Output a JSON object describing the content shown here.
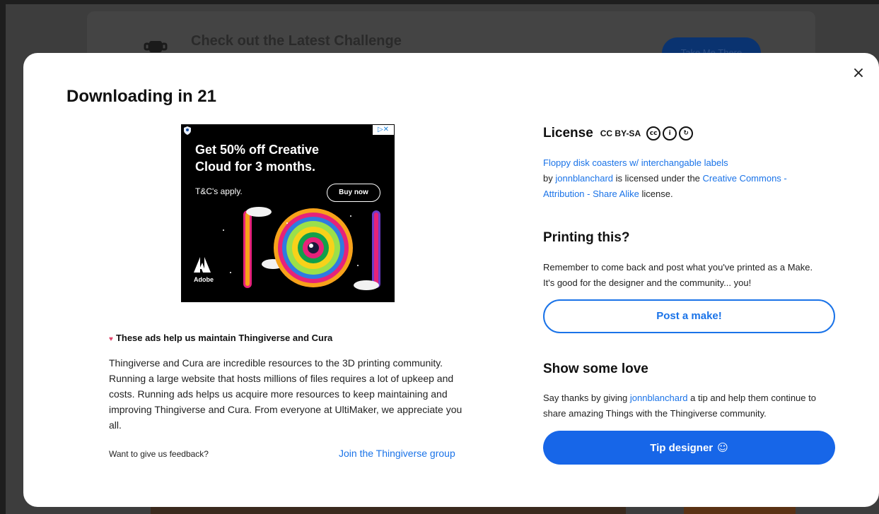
{
  "background": {
    "banner_title": "Check out the Latest Challenge",
    "banner_button": "Take Me There"
  },
  "modal": {
    "title": "Downloading in 21",
    "close_icon": "×",
    "ad": {
      "headline": "Get 50% off Creative Cloud for 3 months.",
      "terms": "T&C's apply.",
      "button": "Buy now",
      "brand": "Adobe",
      "choices_icon": "▷✕"
    },
    "ads_help": {
      "title": "These ads help us maintain Thingiverse and Cura",
      "body": "Thingiverse and Cura are incredible resources to the 3D printing community. Running a large website that hosts millions of files requires a lot of upkeep and costs. Running ads helps us acquire more resources to keep maintaining and improving Thingiverse and Cura. From everyone at UltiMaker, we appreciate you all.",
      "feedback_label": "Want to give us feedback?",
      "feedback_link": "Join the Thingiverse group"
    },
    "license": {
      "title": "License",
      "code": "CC BY-SA",
      "icons": [
        "cc",
        "by",
        "sa"
      ],
      "thing_link": "Floppy disk coasters w/ interchangable labels",
      "by_text": "by",
      "author": "jonnblanchard",
      "licensed_text": "is licensed under the",
      "license_link": "Creative Commons - Attribution - Share Alike",
      "suffix": "license."
    },
    "printing": {
      "title": "Printing this?",
      "text": "Remember to come back and post what you've printed as a Make. It's good for the designer and the community... you!",
      "button": "Post a make!"
    },
    "love": {
      "title": "Show some love",
      "text_pre": "Say thanks by giving",
      "author": "jonnblanchard",
      "text_post": "a tip and help them continue to share amazing Things with the Thingiverse community.",
      "button": "Tip designer",
      "button_icon": "☺"
    }
  }
}
